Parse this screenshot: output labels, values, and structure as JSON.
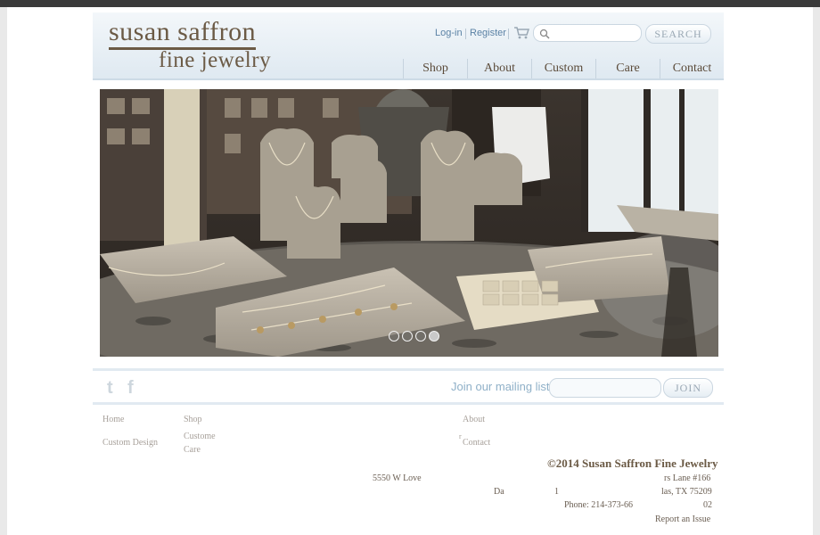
{
  "logo": {
    "line1": "susan saffron",
    "line2": "fine jewelry"
  },
  "utility": {
    "login": "Log-in",
    "register": "Register",
    "search_placeholder": "",
    "search_button": "SEARCH"
  },
  "nav": [
    {
      "label": "Shop"
    },
    {
      "label": "About"
    },
    {
      "label": "Custom"
    },
    {
      "label": "Care"
    },
    {
      "label": "Contact"
    }
  ],
  "slider": {
    "dot_count": 4,
    "active_dot": 4
  },
  "newsletter": {
    "label": "Join our mailing list:",
    "input_value": "",
    "button": "JOIN"
  },
  "footer": {
    "links": {
      "home": "Home",
      "shop": "Shop",
      "custom_design": "Custom Design",
      "custome": "Custome",
      "care": "Care",
      "about": "About",
      "r": "r",
      "contact": "Contact"
    },
    "copyright": "©2014 Susan Saffron Fine Jewelry",
    "address": {
      "part_a": "5550 W Love",
      "part_b": "rs Lane #166",
      "part_c": "Da",
      "part_d": "1",
      "part_e": "las, TX 75209",
      "phone": "Phone: 214-373-66",
      "phone_end": "02"
    },
    "report": "Report an Issue"
  },
  "colors": {
    "brand": "#6b5a45",
    "link_blue": "#5b82a5",
    "header_bg": "#dfe9f1"
  }
}
